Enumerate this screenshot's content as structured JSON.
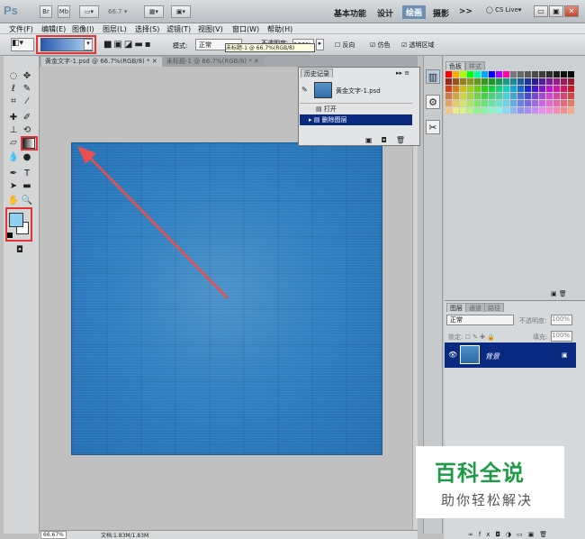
{
  "app": {
    "logo": "Ps",
    "top_buttons": [
      "Br",
      "Mb"
    ],
    "zoom": "66.7",
    "workspace_tabs": [
      "基本功能",
      "设计",
      "绘画",
      "摄影",
      ">>"
    ],
    "active_workspace": "绘画",
    "cs_live": "CS Live▾"
  },
  "menu": [
    "文件(F)",
    "编辑(E)",
    "图像(I)",
    "图层(L)",
    "选择(S)",
    "滤镜(T)",
    "视图(V)",
    "窗口(W)",
    "帮助(H)"
  ],
  "options": {
    "mode_label": "模式:",
    "mode_value": "正常",
    "opacity_label": "不透明度:",
    "opacity_value": "100%",
    "reverse": "反向",
    "dither": "仿色",
    "transparency": "透明区域",
    "tooltip": "未标题-1 @ 66.7%(RGB/8)"
  },
  "doc_tabs": [
    {
      "label": "黄金文字-1.psd @ 66.7%(RGB/8) *",
      "close": "✕"
    },
    {
      "label": "未标题-1 @ 66.7%(RGB/8) *",
      "close": "✕"
    }
  ],
  "status": {
    "zoom": "66.67%",
    "doc": "文档:1.83M/1.83M"
  },
  "history": {
    "tab": "历史记录",
    "snapshot": "黄金文字-1.psd",
    "items": [
      {
        "label": "打开",
        "active": false
      },
      {
        "label": "删除图层",
        "active": true
      }
    ]
  },
  "swatch_tabs": [
    "色板",
    "样式"
  ],
  "layers": {
    "tabs": [
      "图层",
      "通道",
      "路径"
    ],
    "blend": "正常",
    "opacity_label": "不透明度:",
    "opacity": "100%",
    "lock_label": "锁定:",
    "fill_label": "填充:",
    "fill": "100%",
    "layer_name": "背景"
  },
  "watermark": {
    "title": "百科全说",
    "subtitle": "助你轻松解决"
  },
  "colors": {
    "document_blue": "#2f7fc1",
    "highlight_red": "#e53232",
    "arrow": "#e85050",
    "selection": "#0a2a82",
    "brand_green": "#1f9b47",
    "foreground": "#8fd0f2",
    "background": "#ffffff"
  }
}
